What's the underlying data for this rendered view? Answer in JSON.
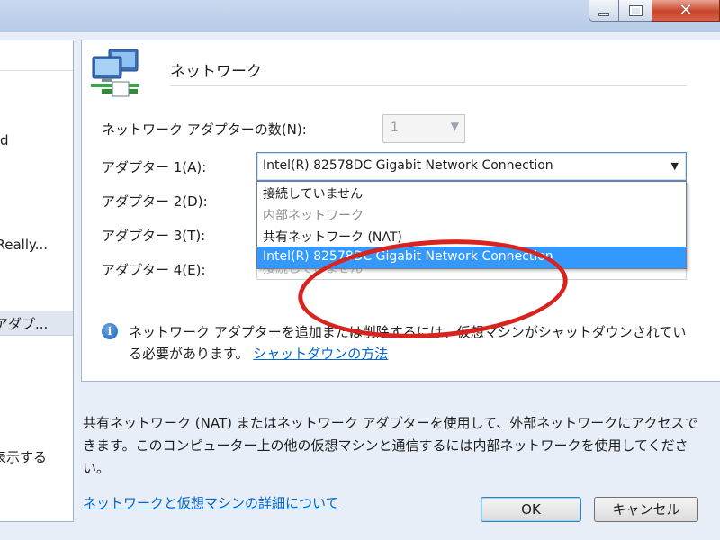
{
  "window": {
    "minimize": "—",
    "maximize": "□",
    "close": "✕"
  },
  "left_pane": {
    "items": [
      "d",
      "uReally...",
      "アダプ...",
      "表示する"
    ]
  },
  "network": {
    "title": "ネットワーク",
    "adapter_count_label": "ネットワーク アダプターの数(N):",
    "adapter_count_value": "1",
    "adapter_labels": [
      "アダプター 1(A):",
      "アダプター 2(D):",
      "アダプター 3(T):",
      "アダプター 4(E):"
    ],
    "adapter1_selected": "Intel(R) 82578DC Gigabit Network Connection",
    "adapter4_value": "接続していません",
    "dropdown_options": [
      "接続していません",
      "内部ネットワーク",
      "共有ネットワーク (NAT)",
      "Intel(R) 82578DC Gigabit Network Connection"
    ],
    "info_text": "ネットワーク アダプターを追加または削除するには、仮想マシンがシャットダウンされている必要があります。",
    "info_link": "シャットダウンの方法"
  },
  "description": "共有ネットワーク (NAT) またはネットワーク アダプターを使用して、外部ネットワークにアクセスできます。このコンピューター上の他の仮想マシンと通信するには内部ネットワークを使用してください。",
  "footer_link": "ネットワークと仮想マシンの詳細について",
  "buttons": {
    "ok": "OK",
    "cancel": "キャンセル"
  },
  "colors": {
    "highlight": "#3399ff",
    "annotation_ring": "#d9231f",
    "link": "#0066cc"
  }
}
